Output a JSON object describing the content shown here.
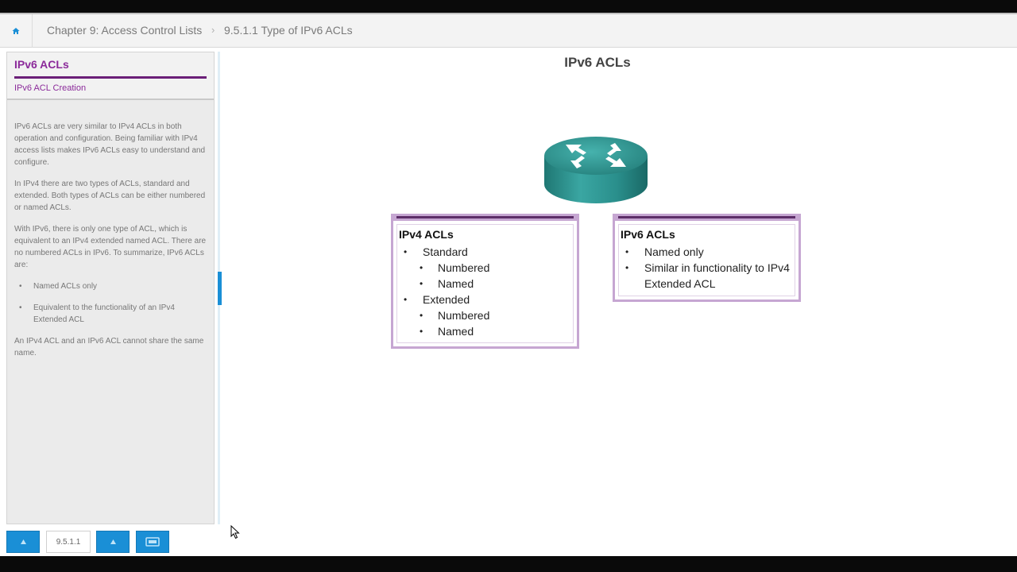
{
  "breadcrumb": {
    "home_icon": "home-icon",
    "chapter": "Chapter 9: Access Control Lists",
    "separator": "›",
    "topic": "9.5.1.1 Type of IPv6 ACLs"
  },
  "sidebar": {
    "title": "IPv6 ACLs",
    "subtitle": "IPv6 ACL Creation",
    "paragraphs": [
      "IPv6 ACLs are very similar to IPv4 ACLs in both operation and configuration. Being familiar with IPv4 access lists makes IPv6 ACLs easy to understand and configure.",
      "In IPv4 there are two types of ACLs, standard and extended. Both types of ACLs can be either numbered or named ACLs.",
      "With IPv6, there is only one type of ACL, which is equivalent to an IPv4 extended named ACL. There are no numbered ACLs in IPv6. To summarize, IPv6 ACLs are:"
    ],
    "bullets": [
      "Named ACLs only",
      "Equivalent to the functionality of an IPv4 Extended ACL"
    ],
    "closing": "An IPv4 ACL and an IPv6 ACL cannot share the same name."
  },
  "content": {
    "title": "IPv6 ACLs",
    "router_icon": "router-icon",
    "ipv4_box": {
      "title": "IPv4 ACLs",
      "items": [
        "Standard",
        "Numbered",
        "Named",
        "Extended",
        "Numbered",
        "Named"
      ]
    },
    "ipv6_box": {
      "title": "IPv6 ACLs",
      "items": [
        "Named only",
        "Similar in functionality to IPv4 Extended ACL"
      ]
    }
  },
  "navigation": {
    "prev_icon": "arrow-left-icon",
    "page": "9.5.1.1",
    "next_icon": "arrow-right-icon",
    "media_icon": "media-icon"
  },
  "colors": {
    "accent_blue": "#1a8fd6",
    "purple_title": "#8b2a9a",
    "box_border": "#c6a6d2",
    "router_teal": "#2a8f8c"
  }
}
